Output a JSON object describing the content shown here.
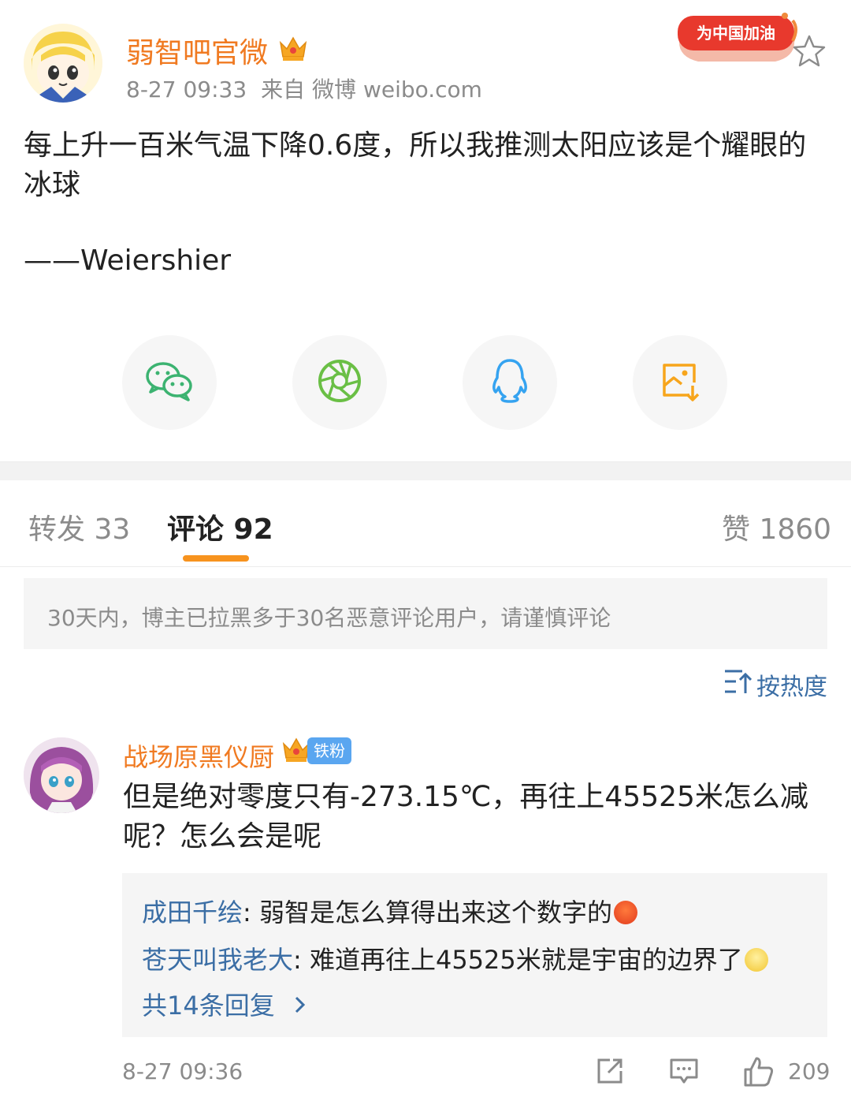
{
  "post": {
    "author": "弱智吧官微",
    "time": "8-27 09:33",
    "source": "来自 微博 weibo.com",
    "badge_text": "为中国加油",
    "text": "每上升一百米气温下降0.6度，所以我推测太阳应该是个耀眼的冰球",
    "signature": "——Weiershier"
  },
  "share": {
    "icons": [
      "wechat-icon",
      "moments-icon",
      "qq-icon",
      "save-image-icon"
    ]
  },
  "tabs": {
    "repost": "转发 33",
    "comments": "评论 92",
    "likes": "赞 1860"
  },
  "notice": "30天内，博主已拉黑多于30名恶意评论用户，请谨慎评论",
  "sort_label": "按热度",
  "comment": {
    "author": "战场原黑仪厨",
    "fan_tag": "铁粉",
    "text": "但是绝对零度只有-273.15℃，再往上45525米怎么减呢？怎么会是呢",
    "replies": [
      {
        "who": "成田千绘",
        "sep": ": ",
        "text": "弱智是怎么算得出来这个数字的"
      },
      {
        "who": "苍天叫我老大",
        "sep": ": ",
        "text": "难道再往上45525米就是宇宙的边界了"
      }
    ],
    "more_replies": "共14条回复",
    "time": "8-27 09:36",
    "likes": "209"
  },
  "colors": {
    "accent_orange": "#f07a21",
    "link_blue": "#3b6ea5",
    "tab_underline": "#f7931e"
  }
}
